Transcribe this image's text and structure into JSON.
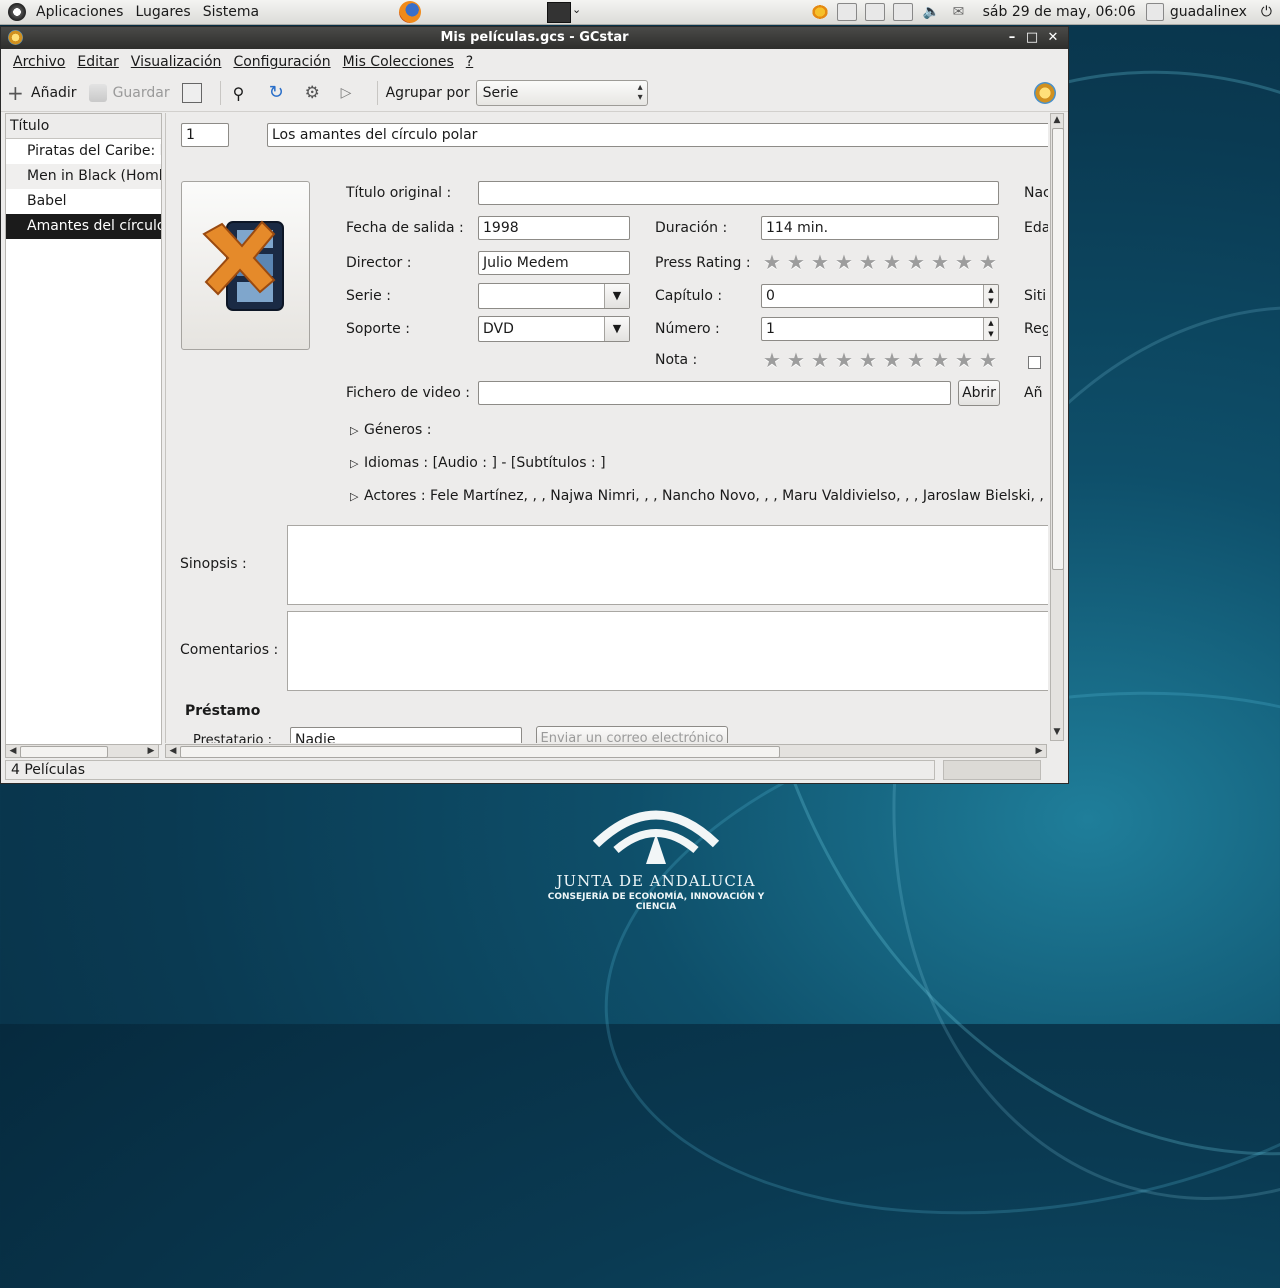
{
  "top_panel": {
    "menus": [
      "Aplicaciones",
      "Lugares",
      "Sistema"
    ],
    "clock": "sáb 29 de may, 06:06",
    "user": "guadalinex"
  },
  "window": {
    "title": "Mis películas.gcs - GCstar",
    "menus": [
      "Archivo",
      "Editar",
      "Visualización",
      "Configuración",
      "Mis Colecciones",
      "?"
    ],
    "toolbar": {
      "add_label": "Añadir",
      "save_label": "Guardar",
      "group_by_label": "Agrupar por",
      "group_by_value": "Serie"
    }
  },
  "list": {
    "header": "Título",
    "items": [
      "Piratas del Caribe: la",
      "Men in Black (Homb",
      "Babel",
      "Amantes del círculo"
    ],
    "selected_index": 3
  },
  "detail": {
    "number": "1",
    "title": "Los amantes del círculo polar",
    "labels": {
      "original_title": "Título original :",
      "release_date": "Fecha de salida :",
      "director": "Director :",
      "series": "Serie :",
      "support": "Soporte :",
      "duration": "Duración :",
      "press_rating": "Press Rating :",
      "chapter": "Capítulo :",
      "number": "Número :",
      "rating": "Nota :",
      "video_file": "Fichero de video :",
      "nationality_partial": "Nac",
      "age_partial": "Eda",
      "site_partial": "Siti",
      "region_partial": "Reg",
      "year_partial": "Añ",
      "synopsis": "Sinopsis :",
      "comments": "Comentarios :",
      "loan": "Préstamo",
      "borrower_partial": "Prestatario :"
    },
    "values": {
      "original_title": "",
      "release_date": "1998",
      "director": "Julio Medem",
      "series": "",
      "support": "DVD",
      "duration": "114 min.",
      "chapter": "0",
      "number": "1",
      "video_file": "",
      "borrower_partial": "Nadie",
      "email_button_partial": "Enviar un correo electrónico"
    },
    "press_rating_stars": 0,
    "rating_stars": 0,
    "stars_max": 10,
    "open_button": "Abrir",
    "expanders": {
      "genres": "Géneros :",
      "languages": "Idiomas : [Audio : ] - [Subtítulos : ]",
      "actors": "Actores : Fele Martínez, , , Najwa Nimri, , , Nancho Novo, , , Maru Valdivielso, , , Jaroslaw Bielski, , , Peru"
    }
  },
  "status": {
    "count": "4 Películas"
  },
  "desktop_logo": {
    "line1": "JUNTA DE ANDALUCIA",
    "line2": "CONSEJERÍA DE ECONOMÍA, INNOVACIÓN Y CIENCIA"
  }
}
